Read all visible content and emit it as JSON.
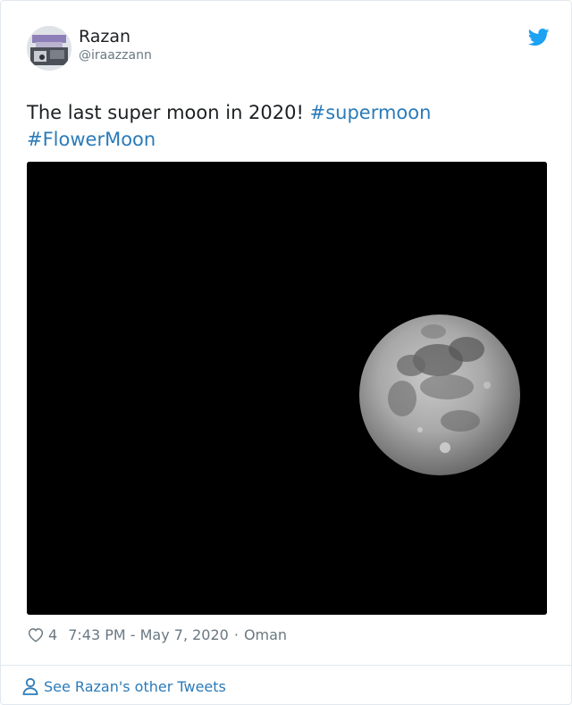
{
  "author": {
    "display_name": "Razan",
    "handle": "@iraazzann"
  },
  "tweet": {
    "text_plain": "The last super moon in 2020! ",
    "hashtags": [
      "#supermoon",
      "#FlowerMoon"
    ]
  },
  "meta": {
    "likes": "4",
    "time": "7:43 PM - May 7, 2020",
    "separator": "·",
    "location": "Oman"
  },
  "footer": {
    "link_label": "See Razan's other Tweets"
  },
  "colors": {
    "link": "#2b7bb9",
    "muted": "#697882",
    "text": "#1c2022",
    "twitter_blue": "#1da1f2"
  },
  "icons": {
    "brand": "twitter-bird-icon",
    "like": "heart-icon",
    "profile": "person-icon"
  }
}
